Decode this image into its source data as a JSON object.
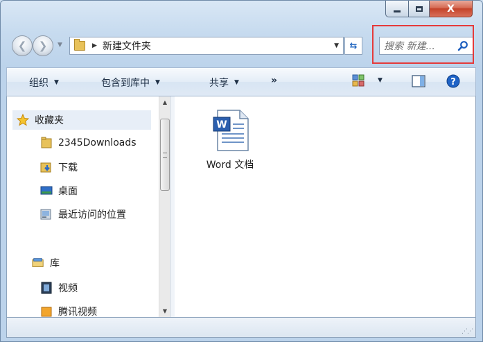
{
  "window": {
    "controls": {
      "minimize_icon": "minimize-icon",
      "maximize_icon": "maximize-icon",
      "close_label": "X"
    },
    "highlight_color": "#e53a3a"
  },
  "navigation": {
    "back_icon": "back-arrow-icon",
    "forward_icon": "forward-arrow-icon",
    "breadcrumb": [
      "新建文件夹"
    ],
    "search_placeholder": "搜索 新建..."
  },
  "toolbar": {
    "organize": "组织",
    "include_in_library": "包含到库中",
    "share": "共享",
    "more": "»"
  },
  "sidebar": {
    "favorites": "收藏夹",
    "items": [
      {
        "label": "2345Downloads",
        "icon": "folder-icon"
      },
      {
        "label": "下载",
        "icon": "download-folder-icon"
      },
      {
        "label": "桌面",
        "icon": "desktop-icon"
      },
      {
        "label": "最近访问的位置",
        "icon": "recent-places-icon"
      }
    ],
    "libraries": "库",
    "library_items": [
      {
        "label": "视频",
        "icon": "video-library-icon"
      },
      {
        "label": "腾讯视频",
        "icon": "folder-icon"
      }
    ]
  },
  "files": [
    {
      "name": "Word 文档",
      "icon": "word-document-icon"
    }
  ],
  "status_bar": {
    "text": ""
  }
}
